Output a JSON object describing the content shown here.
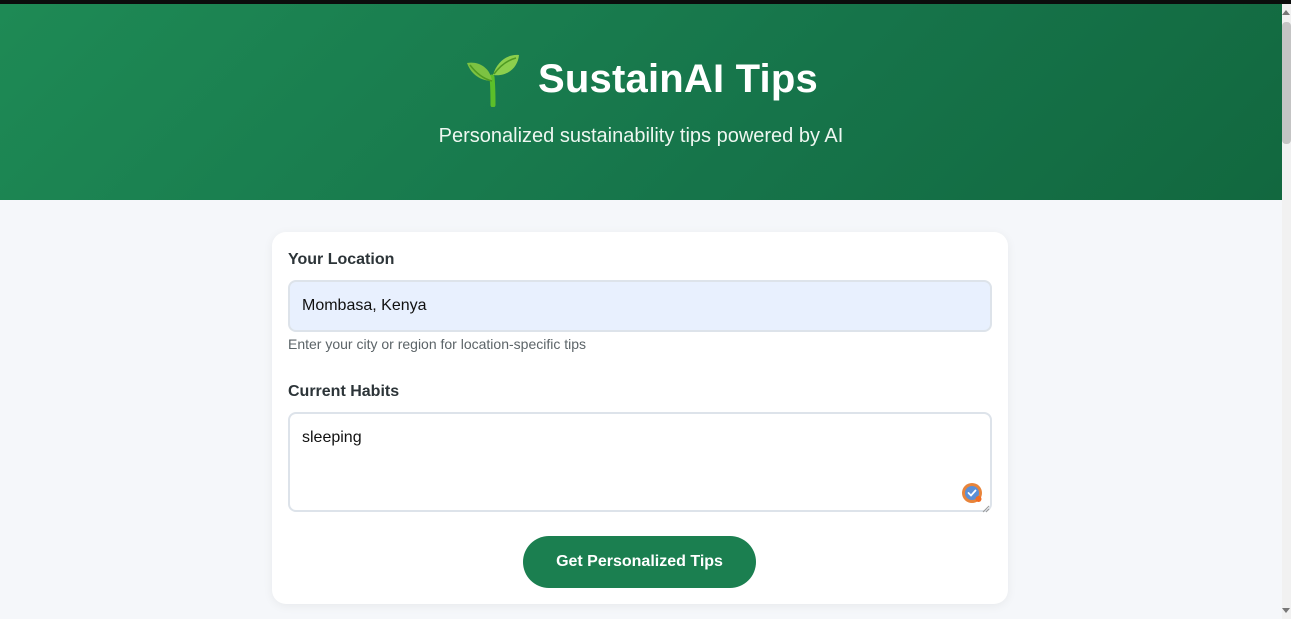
{
  "header": {
    "icon": "seedling-icon",
    "title": "SustainAI Tips",
    "subtitle": "Personalized sustainability tips powered by AI"
  },
  "form": {
    "location": {
      "label": "Your Location",
      "value": "Mombasa, Kenya",
      "hint": "Enter your city or region for location-specific tips"
    },
    "habits": {
      "label": "Current Habits",
      "value": "sleeping"
    },
    "submit_label": "Get Personalized Tips"
  },
  "colors": {
    "header_gradient_start": "#1e8a55",
    "header_gradient_end": "#12683f",
    "button": "#1b7f50",
    "autofill_bg": "#e8f0fe"
  }
}
